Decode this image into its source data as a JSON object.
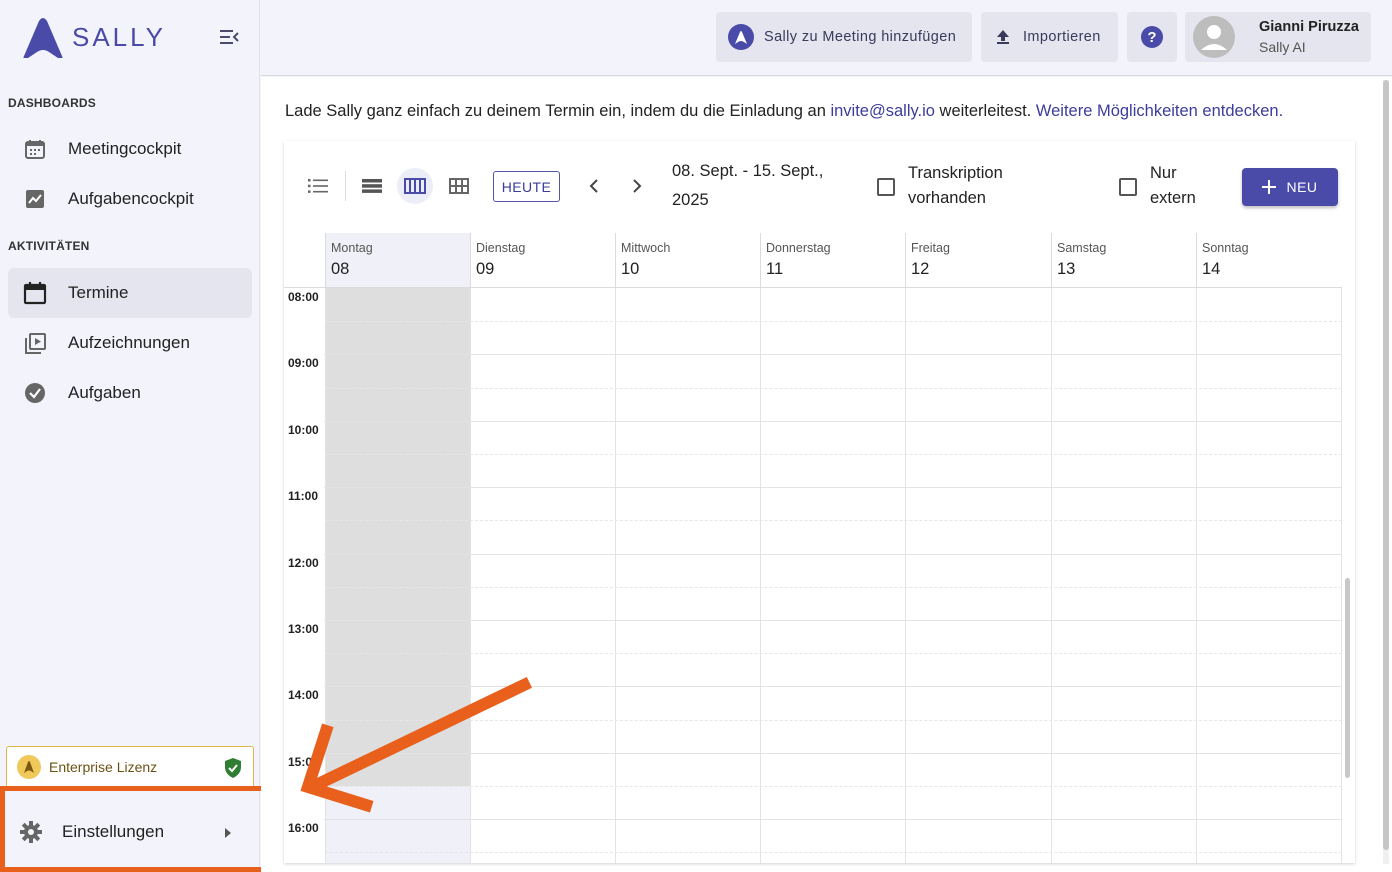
{
  "brand": {
    "name": "SALLY"
  },
  "sidebar": {
    "dashboards_title": "DASHBOARDS",
    "activities_title": "AKTIVITÄTEN",
    "items": [
      {
        "label": "Meetingcockpit",
        "icon": "calendar-grid-icon"
      },
      {
        "label": "Aufgabencockpit",
        "icon": "chart-icon"
      },
      {
        "label": "Termine",
        "icon": "calendar-icon",
        "active": true
      },
      {
        "label": "Aufzeichnungen",
        "icon": "video-library-icon"
      },
      {
        "label": "Aufgaben",
        "icon": "check-circle-icon"
      }
    ],
    "license_label": "Enterprise Lizenz",
    "settings_label": "Einstellungen"
  },
  "topbar": {
    "add_meeting_label": "Sally zu Meeting hinzufügen",
    "import_label": "Importieren",
    "help_icon": "help-icon",
    "user_name": "Gianni Piruzza",
    "user_sub": "Sally AI"
  },
  "info": {
    "text_1": "Lade Sally ganz einfach zu deinem Termin ein, indem du die Einladung an ",
    "email": "invite@sally.io",
    "text_2": " weiterleitest. ",
    "more_link": "Weitere Möglichkeiten entdecken."
  },
  "toolbar": {
    "today_label": "HEUTE",
    "range_line_1": "08. Sept. - 15. Sept.,",
    "range_line_2": "2025",
    "filter_transcription_1": "Transkription",
    "filter_transcription_2": "vorhanden",
    "filter_external_1": "Nur",
    "filter_external_2": "extern",
    "new_label": "NEU"
  },
  "calendar": {
    "days": [
      {
        "name": "Montag",
        "num": "08"
      },
      {
        "name": "Dienstag",
        "num": "09"
      },
      {
        "name": "Mittwoch",
        "num": "10"
      },
      {
        "name": "Donnerstag",
        "num": "11"
      },
      {
        "name": "Freitag",
        "num": "12"
      },
      {
        "name": "Samstag",
        "num": "13"
      },
      {
        "name": "Sonntag",
        "num": "14"
      }
    ],
    "hours": [
      "08:00",
      "09:00",
      "10:00",
      "11:00",
      "12:00",
      "13:00",
      "14:00",
      "15:00",
      "16:00"
    ]
  },
  "colors": {
    "accent": "#4a4aa8",
    "highlight": "#e8601c",
    "past": "#dedede"
  }
}
